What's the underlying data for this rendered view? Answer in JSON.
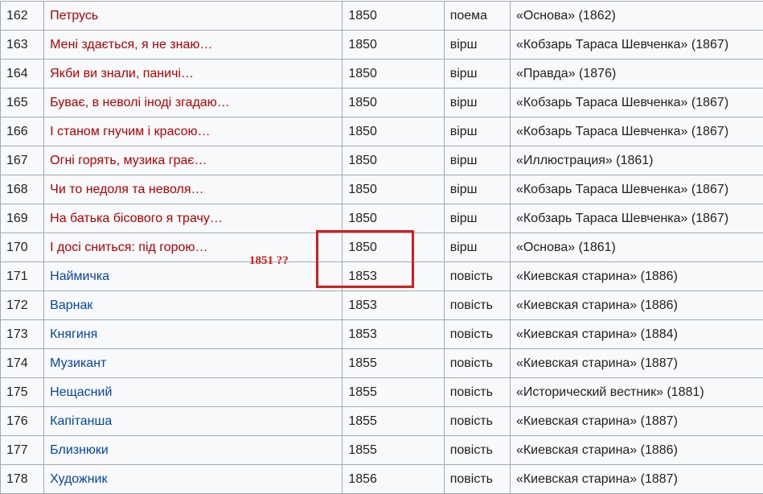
{
  "table": {
    "rows": [
      {
        "num": "162",
        "title": "Петрусь",
        "year": "1850",
        "genre": "поема",
        "publication": "«Основа» (1862)",
        "link_status": "missing"
      },
      {
        "num": "163",
        "title": "Мені здається, я не знаю…",
        "year": "1850",
        "genre": "вірш",
        "publication": "«Кобзарь Тараса Шевченка» (1867)",
        "link_status": "missing"
      },
      {
        "num": "164",
        "title": "Якби ви знали, паничі…",
        "year": "1850",
        "genre": "вірш",
        "publication": "«Правда» (1876)",
        "link_status": "missing"
      },
      {
        "num": "165",
        "title": "Буває, в неволі іноді згадаю…",
        "year": "1850",
        "genre": "вірш",
        "publication": "«Кобзарь Тараса Шевченка» (1867)",
        "link_status": "missing"
      },
      {
        "num": "166",
        "title": "І станом гнучим і красою…",
        "year": "1850",
        "genre": "вірш",
        "publication": "«Кобзарь Тараса Шевченка» (1867)",
        "link_status": "missing"
      },
      {
        "num": "167",
        "title": "Огні горять, музика грає…",
        "year": "1850",
        "genre": "вірш",
        "publication": "«Иллюстрация» (1861)",
        "link_status": "missing"
      },
      {
        "num": "168",
        "title": "Чи то недоля та неволя…",
        "year": "1850",
        "genre": "вірш",
        "publication": "«Кобзарь Тараса Шевченка» (1867)",
        "link_status": "missing"
      },
      {
        "num": "169",
        "title": "На батька бісового я трачу…",
        "year": "1850",
        "genre": "вірш",
        "publication": "«Кобзарь Тараса Шевченка» (1867)",
        "link_status": "missing"
      },
      {
        "num": "170",
        "title": "І досі сниться: під горою…",
        "year": "1850",
        "genre": "вірш",
        "publication": "«Основа» (1861)",
        "link_status": "missing"
      },
      {
        "num": "171",
        "title": "Наймичка",
        "year": "1853",
        "genre": "повість",
        "publication": "«Киевская старина» (1886)",
        "link_status": "existing"
      },
      {
        "num": "172",
        "title": "Варнак",
        "year": "1853",
        "genre": "повість",
        "publication": "«Киевская старина» (1886)",
        "link_status": "existing"
      },
      {
        "num": "173",
        "title": "Княгиня",
        "year": "1853",
        "genre": "повість",
        "publication": "«Киевская старина» (1884)",
        "link_status": "existing"
      },
      {
        "num": "174",
        "title": "Музикант",
        "year": "1855",
        "genre": "повість",
        "publication": "«Киевская старина» (1887)",
        "link_status": "existing"
      },
      {
        "num": "175",
        "title": "Нещасний",
        "year": "1855",
        "genre": "повість",
        "publication": "«Исторический вестник» (1881)",
        "link_status": "existing"
      },
      {
        "num": "176",
        "title": "Капітанша",
        "year": "1855",
        "genre": "повість",
        "publication": "«Киевская старина» (1887)",
        "link_status": "existing"
      },
      {
        "num": "177",
        "title": "Близнюки",
        "year": "1855",
        "genre": "повість",
        "publication": "«Киевская старина» (1886)",
        "link_status": "existing"
      },
      {
        "num": "178",
        "title": "Художник",
        "year": "1856",
        "genre": "повість",
        "publication": "«Киевская старина» (1887)",
        "link_status": "existing"
      }
    ]
  },
  "annotation": {
    "text": "1851 ??",
    "color": "#d81b1b"
  },
  "colors": {
    "missing_link": "#ba0000",
    "existing_link": "#0645ad",
    "cell_background": "#f8f9fa",
    "border": "#a2a9b1"
  }
}
